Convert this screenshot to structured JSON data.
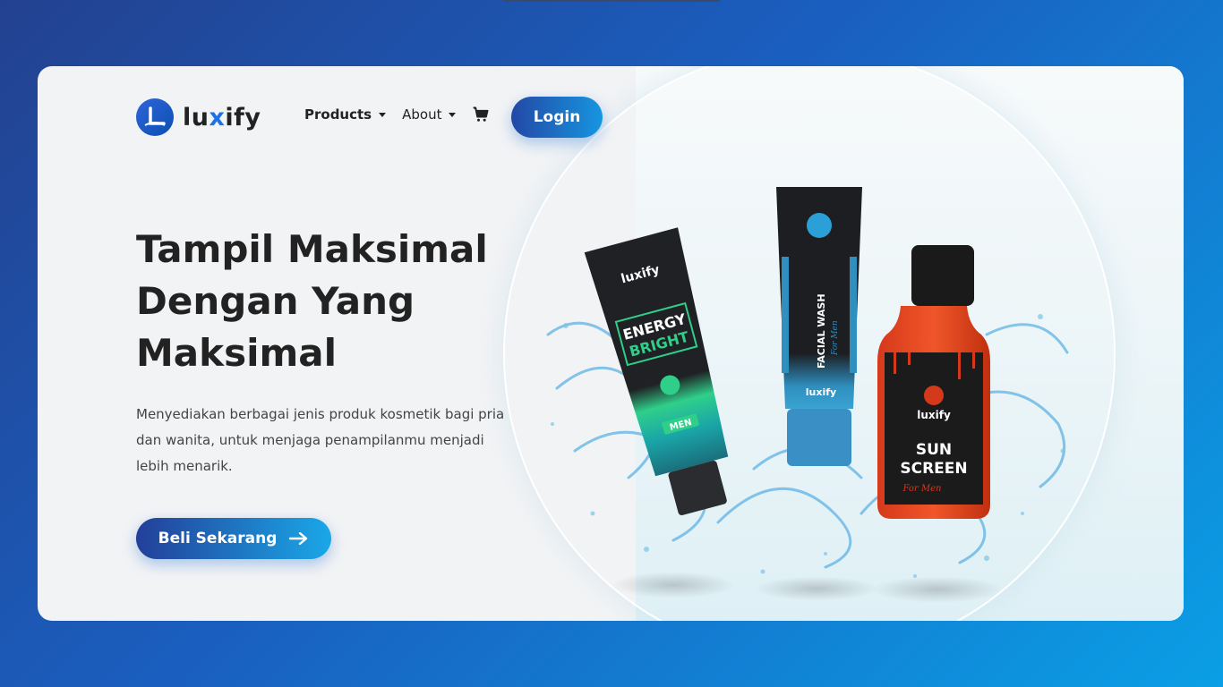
{
  "brand": {
    "name_pre": "lu",
    "name_x": "x",
    "name_post": "ify"
  },
  "nav": {
    "products_label": "Products",
    "about_label": "About",
    "login_label": "Login"
  },
  "hero": {
    "headline_line1": "Tampil Maksimal",
    "headline_line2": "Dengan Yang",
    "headline_line3": "Maksimal",
    "description": "Menyediakan berbagai jenis produk kosmetik bagi pria dan wanita, untuk menjaga penampilanmu menjadi lebih menarik.",
    "cta_label": "Beli Sekarang"
  },
  "products": {
    "tube1": {
      "brand": "luxify",
      "line1": "ENERGY",
      "line2": "BRIGHT",
      "badge": "MEN"
    },
    "tube2": {
      "name": "FACIAL WASH",
      "sub": "For Men",
      "brand": "luxify"
    },
    "bottle": {
      "brand": "luxify",
      "line1": "SUN",
      "line2": "SCREEN",
      "sub": "For Men"
    }
  },
  "colors": {
    "accent_dark": "#233f99",
    "accent_light": "#1aa8e8",
    "text_dark": "#222222"
  },
  "icons": {
    "cart": "cart-icon",
    "arrow": "arrow-right-icon",
    "caret": "chevron-down-icon"
  }
}
